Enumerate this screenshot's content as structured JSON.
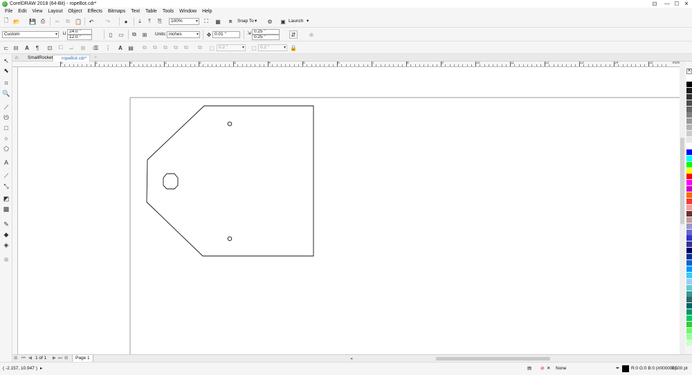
{
  "window": {
    "title": "CorelDRAW 2018 (64-Bit) - ropeBot.cdr*",
    "controls": [
      "⊡",
      "—",
      "☐",
      "✕"
    ]
  },
  "menu": [
    "File",
    "Edit",
    "View",
    "Layout",
    "Object",
    "Effects",
    "Bitmaps",
    "Text",
    "Table",
    "Tools",
    "Window",
    "Help"
  ],
  "toolbar1": {
    "zoom": "100%",
    "snap_to": "Snap To",
    "launch": "Launch"
  },
  "propertybar": {
    "page_preset": "Custom",
    "width": "24.0 \"",
    "height": "12.0 \"",
    "units_label": "Units:",
    "units": "inches",
    "nudge": "0.01 \"",
    "dup_x": "0.25 \"",
    "dup_y": "0.25 \""
  },
  "toolbar3": {
    "corner_a": "0.2 \"",
    "corner_b": "0.2 \""
  },
  "tabs": [
    {
      "label": "SmallRocket.cdr*",
      "active": false
    },
    {
      "label": "ropeBot.cdr*",
      "active": true
    }
  ],
  "ruler": {
    "unit_label": "inches",
    "labels": [
      "2",
      "1",
      "0",
      "1",
      "2",
      "3",
      "4",
      "5",
      "6",
      "7",
      "8",
      "9",
      "10",
      "11",
      "12",
      "13",
      "14",
      "15"
    ]
  },
  "pagenav": {
    "page_of": "1 of 1",
    "page_tab": "Page 1"
  },
  "status": {
    "coords": "( -2.157, 10.947 )",
    "fill": "None",
    "outline_color": "R:0 G:0 B:0 (#000000)",
    "outline_width": "0.500 pt"
  },
  "palette_colors": [
    "#ffffff",
    "#000000",
    "#1a1a1a",
    "#333333",
    "#4d4d4d",
    "#666666",
    "#808080",
    "#999999",
    "#b3b3b3",
    "#cccccc",
    "#e6e6e6",
    "#ffffff",
    "#0000ff",
    "#00ffff",
    "#00ff00",
    "#ffff00",
    "#ff0000",
    "#ff00ff",
    "#cc00cc",
    "#ff6600",
    "#ff3333",
    "#ff9999",
    "#663333",
    "#cc9999",
    "#9999cc",
    "#6666cc",
    "#3333cc",
    "#333399",
    "#000066",
    "#003399",
    "#0066cc",
    "#0099ff",
    "#33ccff",
    "#99ccff",
    "#66cccc",
    "#339999",
    "#336666",
    "#006666",
    "#009966",
    "#00cc66",
    "#33cc33",
    "#66ff66",
    "#99ff99",
    "#ccffcc"
  ]
}
